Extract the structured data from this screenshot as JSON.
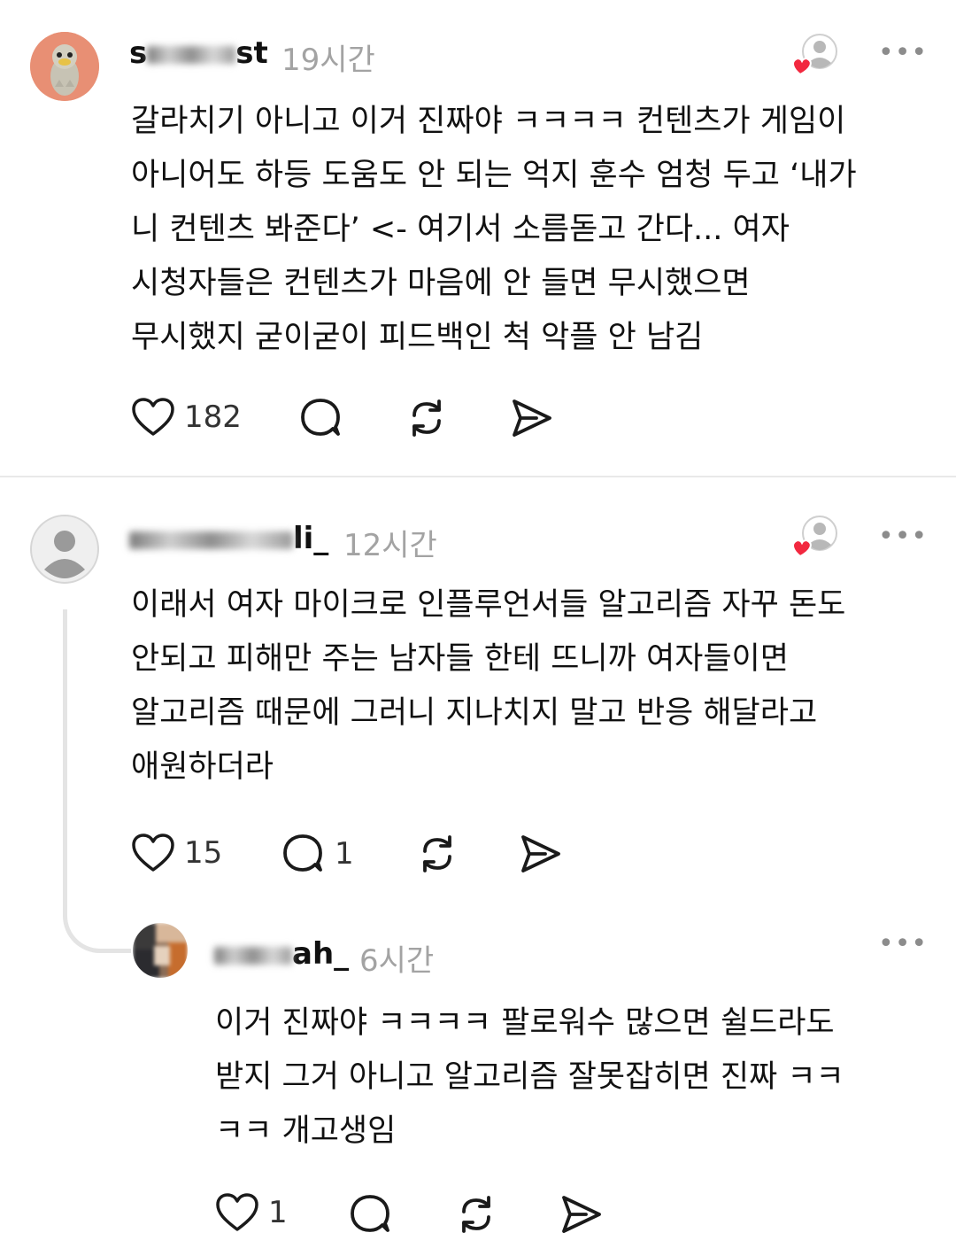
{
  "comments": [
    {
      "username_visible_prefix": "s",
      "username_visible_suffix": "st",
      "time": "19시간",
      "lines": [
        "갈라치기 아니고 이거 진짜야 ㅋㅋㅋㅋ 컨텐츠가 게임이",
        "아니어도 하등 도움도 안 되는 억지 훈수 엄청 두고 ‘내가",
        "니 컨텐츠 봐준다’ <- 여기서 소름돋고 간다... 여자",
        "시청자들은 컨텐츠가 마음에 안 들면 무시했으면",
        "무시했지 굳이굳이 피드백인 척 악플 안 남김"
      ],
      "likes": "182",
      "replies": ""
    },
    {
      "username_visible_prefix": "",
      "username_visible_suffix": "li_",
      "time": "12시간",
      "lines": [
        "이래서 여자 마이크로 인플루언서들 알고리즘 자꾸 돈도",
        "안되고 피해만 주는 남자들 한테 뜨니까 여자들이면",
        "알고리즘 때문에 그러니 지나치지 말고 반응 해달라고",
        "애원하더라"
      ],
      "likes": "15",
      "replies": "1"
    },
    {
      "username_visible_prefix": "",
      "username_visible_suffix": "ah_",
      "time": "6시간",
      "lines": [
        "이거 진짜야 ㅋㅋㅋㅋ 팔로워수 많으면 쉴드라도",
        "받지 그거 아니고 알고리즘 잘못잡히면 진짜 ㅋㅋ",
        "ㅋㅋ 개고생임"
      ],
      "likes": "1",
      "replies": ""
    }
  ],
  "more_label": "•••",
  "colors": {
    "heart_red": "#f2283f",
    "icon_dark": "#1a1a1a",
    "muted": "#a3a3a3"
  },
  "icons": [
    "heart-icon",
    "comment-icon",
    "repost-icon",
    "share-icon",
    "author-liked-icon",
    "more-icon"
  ]
}
